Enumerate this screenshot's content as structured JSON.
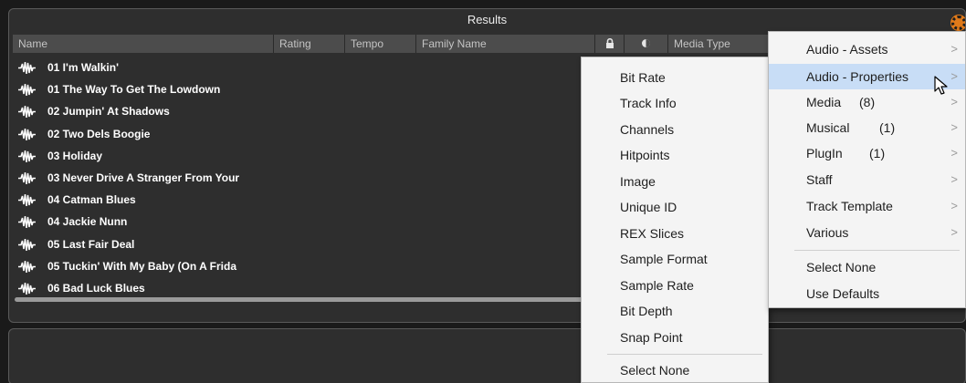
{
  "panel": {
    "title": "Results"
  },
  "columns": [
    {
      "label": "Name"
    },
    {
      "label": "Rating"
    },
    {
      "label": "Tempo"
    },
    {
      "label": "Family Name"
    },
    {
      "label": ""
    },
    {
      "label": ""
    },
    {
      "label": "Media Type"
    }
  ],
  "results": [
    "01 I'm Walkin'",
    "01 The Way To Get The Lowdown",
    "02 Jumpin' At Shadows",
    "02 Two Dels Boogie",
    "03 Holiday",
    "03 Never Drive A Stranger From Your",
    "04 Catman Blues",
    "04 Jackie Nunn",
    "05 Last Fair Deal",
    "05 Tuckin' With My Baby (On A Frida",
    "06 Bad Luck Blues"
  ],
  "submenu": {
    "items": [
      "Bit Rate",
      "Track Info",
      "Channels",
      "Hitpoints",
      "Image",
      "Unique ID",
      "REX Slices",
      "Sample Format",
      "Sample Rate",
      "Bit Depth",
      "Snap Point"
    ],
    "select_none": "Select None"
  },
  "mainmenu": {
    "items": [
      {
        "label": "Audio - Assets",
        "count": "",
        "highlighted": false
      },
      {
        "label": "Audio - Properties",
        "count": "",
        "highlighted": true
      },
      {
        "label": "Media",
        "count": "(8)",
        "highlighted": false
      },
      {
        "label": "Musical",
        "count": "(1)",
        "highlighted": false
      },
      {
        "label": "PlugIn",
        "count": "(1)",
        "highlighted": false
      },
      {
        "label": "Staff",
        "count": "",
        "highlighted": false
      },
      {
        "label": "Track Template",
        "count": "",
        "highlighted": false
      },
      {
        "label": "Various",
        "count": "",
        "highlighted": false
      }
    ],
    "chevron": ">",
    "select_none": "Select None",
    "use_defaults": "Use Defaults"
  },
  "colors": {
    "accent": "#e07a1a",
    "highlight": "#c8ddf6"
  }
}
